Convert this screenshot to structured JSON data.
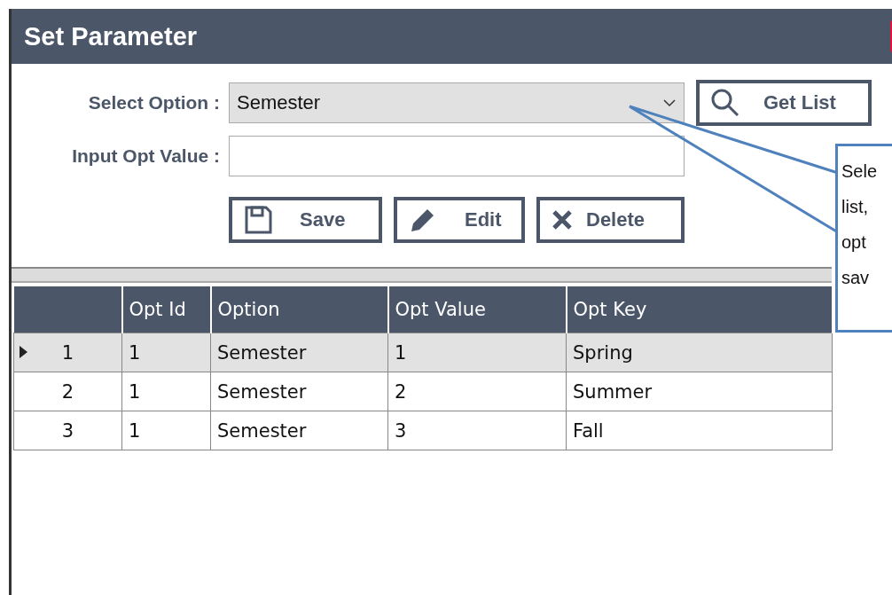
{
  "window": {
    "title": "Set Parameter"
  },
  "form": {
    "select_label": "Select Option :",
    "select_value": "Semester",
    "input_label": "Input Opt Value :",
    "get_list": "Get List"
  },
  "buttons": [
    {
      "kind": "save",
      "label": "Save"
    },
    {
      "kind": "edit",
      "label": "Edit"
    },
    {
      "kind": "delete",
      "label": "Delete"
    }
  ],
  "table": {
    "columns": [
      "",
      "Opt Id",
      "Option",
      "Opt Value",
      "Opt Key"
    ],
    "rows": [
      {
        "selected": true,
        "cells": [
          "1",
          "1",
          "Semester",
          "1",
          "Spring"
        ]
      },
      {
        "selected": false,
        "cells": [
          "2",
          "1",
          "Semester",
          "2",
          "Summer"
        ]
      },
      {
        "selected": false,
        "cells": [
          "3",
          "1",
          "Semester",
          "3",
          "Fall"
        ]
      }
    ]
  },
  "callout": {
    "lines": [
      "Sele",
      "list,",
      "opt",
      "sav"
    ]
  }
}
